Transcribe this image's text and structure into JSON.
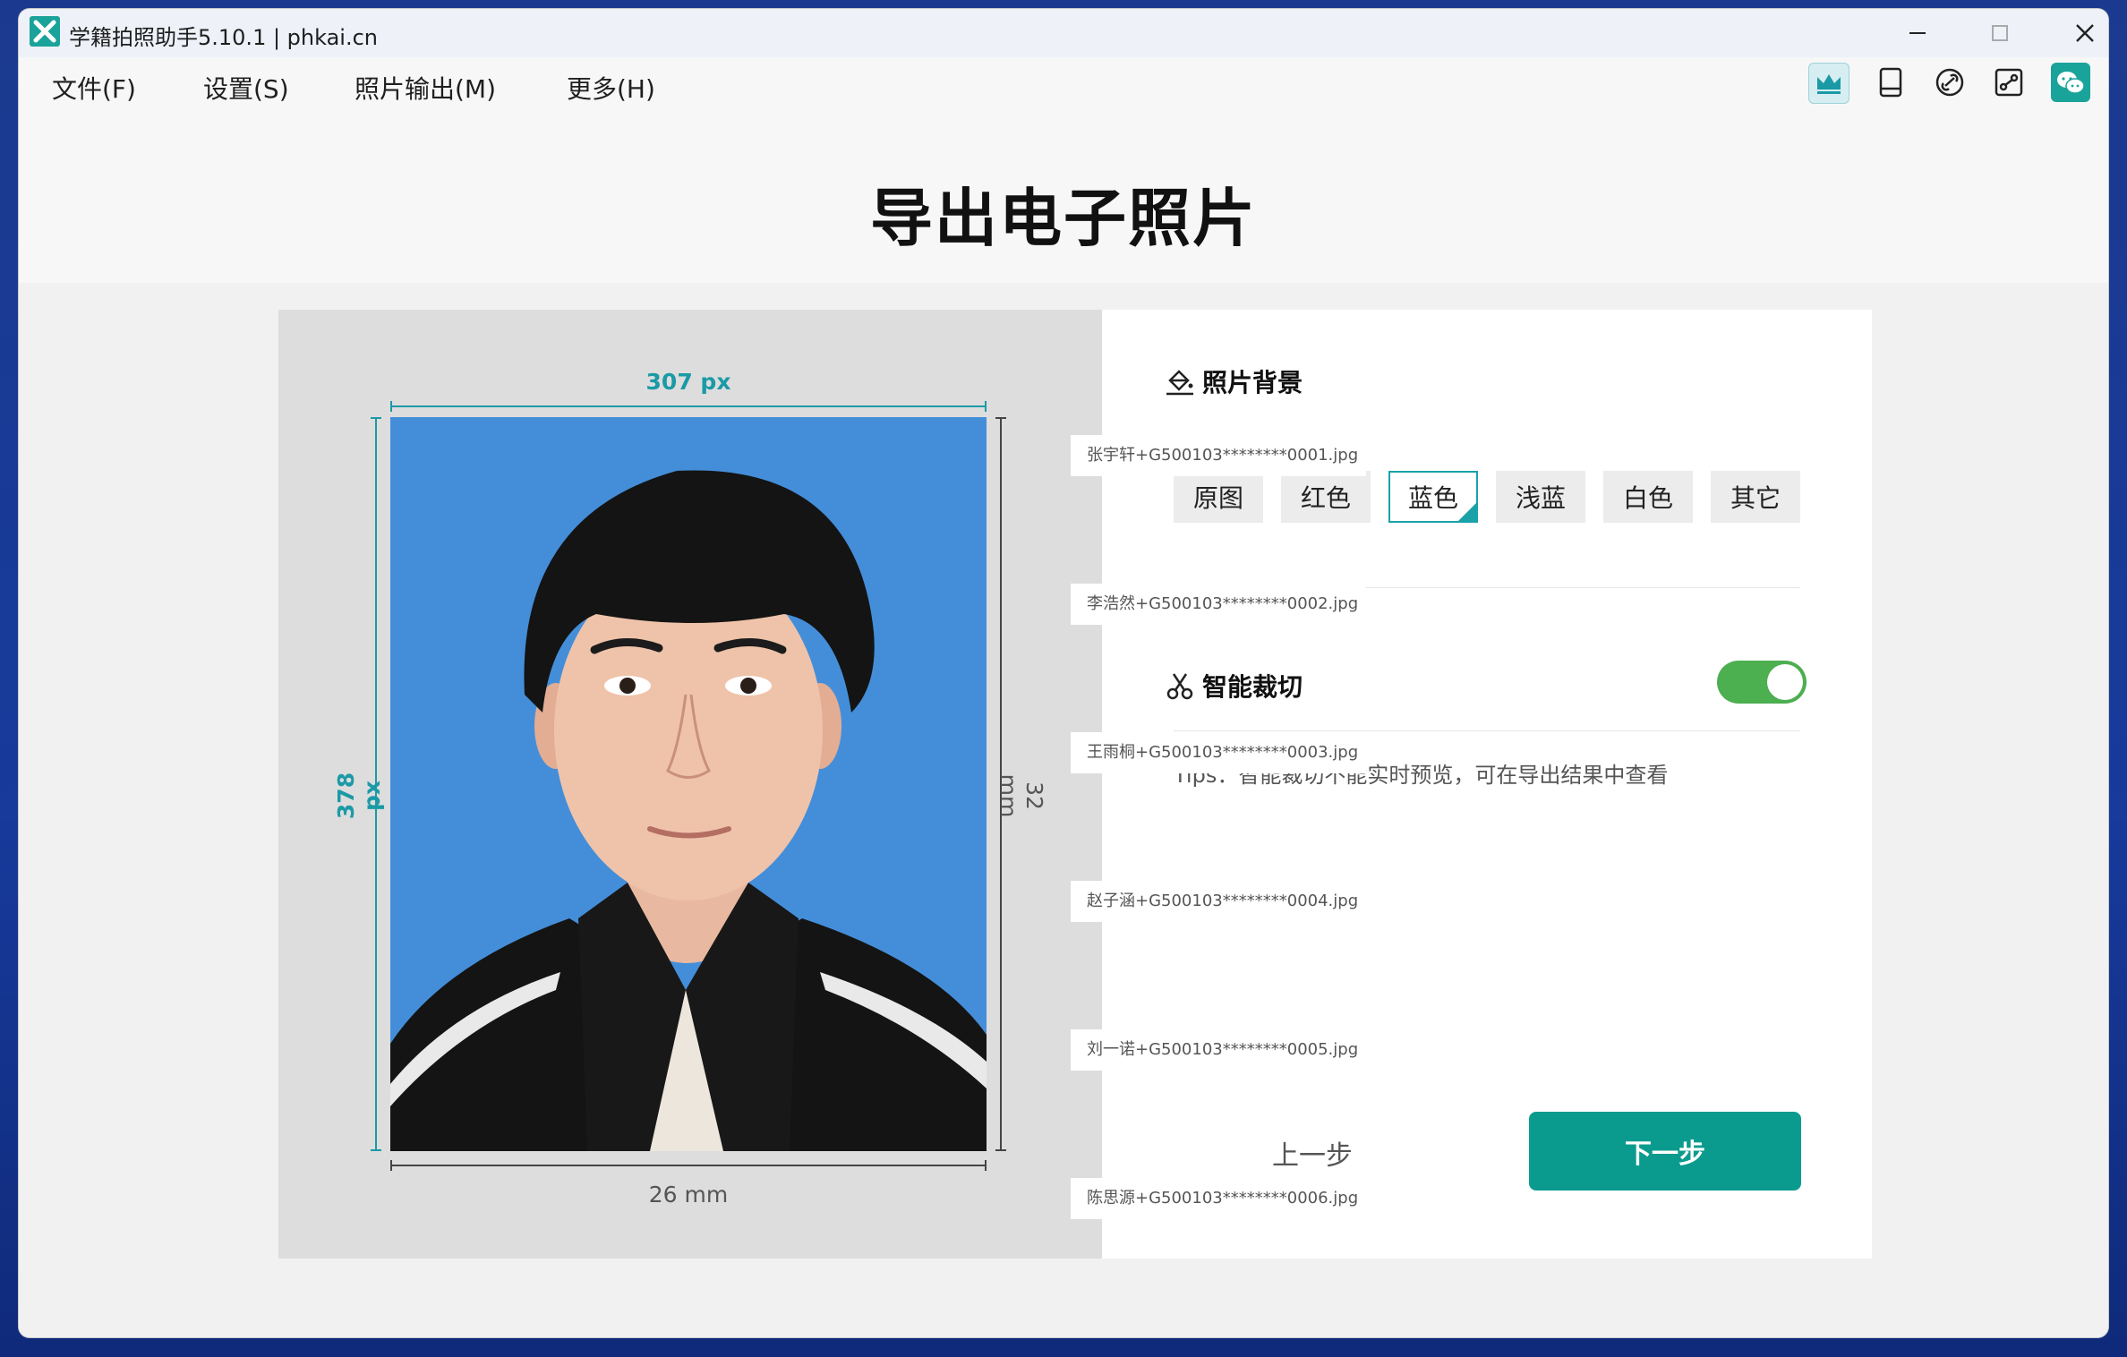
{
  "window": {
    "title": "学籍拍照助手5.10.1 | phkai.cn"
  },
  "menu": {
    "file": "文件(F)",
    "settings": "设置(S)",
    "photo_output": "照片输出(M)",
    "more": "更多(H)"
  },
  "page_title": "导出电子照片",
  "preview": {
    "width_px": "307 px",
    "height_px": "378 px",
    "width_mm": "26 mm",
    "height_mm": "32 mm"
  },
  "background_section": {
    "title": "照片背景",
    "options": [
      "原图",
      "红色",
      "蓝色",
      "浅蓝",
      "白色",
      "其它"
    ],
    "selected": "蓝色"
  },
  "crop_section": {
    "title": "智能裁切",
    "enabled": true,
    "tips": "Tips：智能裁切不能实时预览，可在导出结果中查看"
  },
  "nav": {
    "prev": "上一步",
    "next": "下一步"
  },
  "files": [
    "张宇轩+G500103********0001.jpg",
    "李浩然+G500103********0002.jpg",
    "王雨桐+G500103********0003.jpg",
    "赵子涵+G500103********0004.jpg",
    "刘一诺+G500103********0005.jpg",
    "陈思源+G500103********0006.jpg"
  ],
  "colors": {
    "accent": "#0a9b8e",
    "teal_dim": "#1b9aa6",
    "photo_bg": "#448ed9",
    "toggle_on": "#4caf50"
  }
}
